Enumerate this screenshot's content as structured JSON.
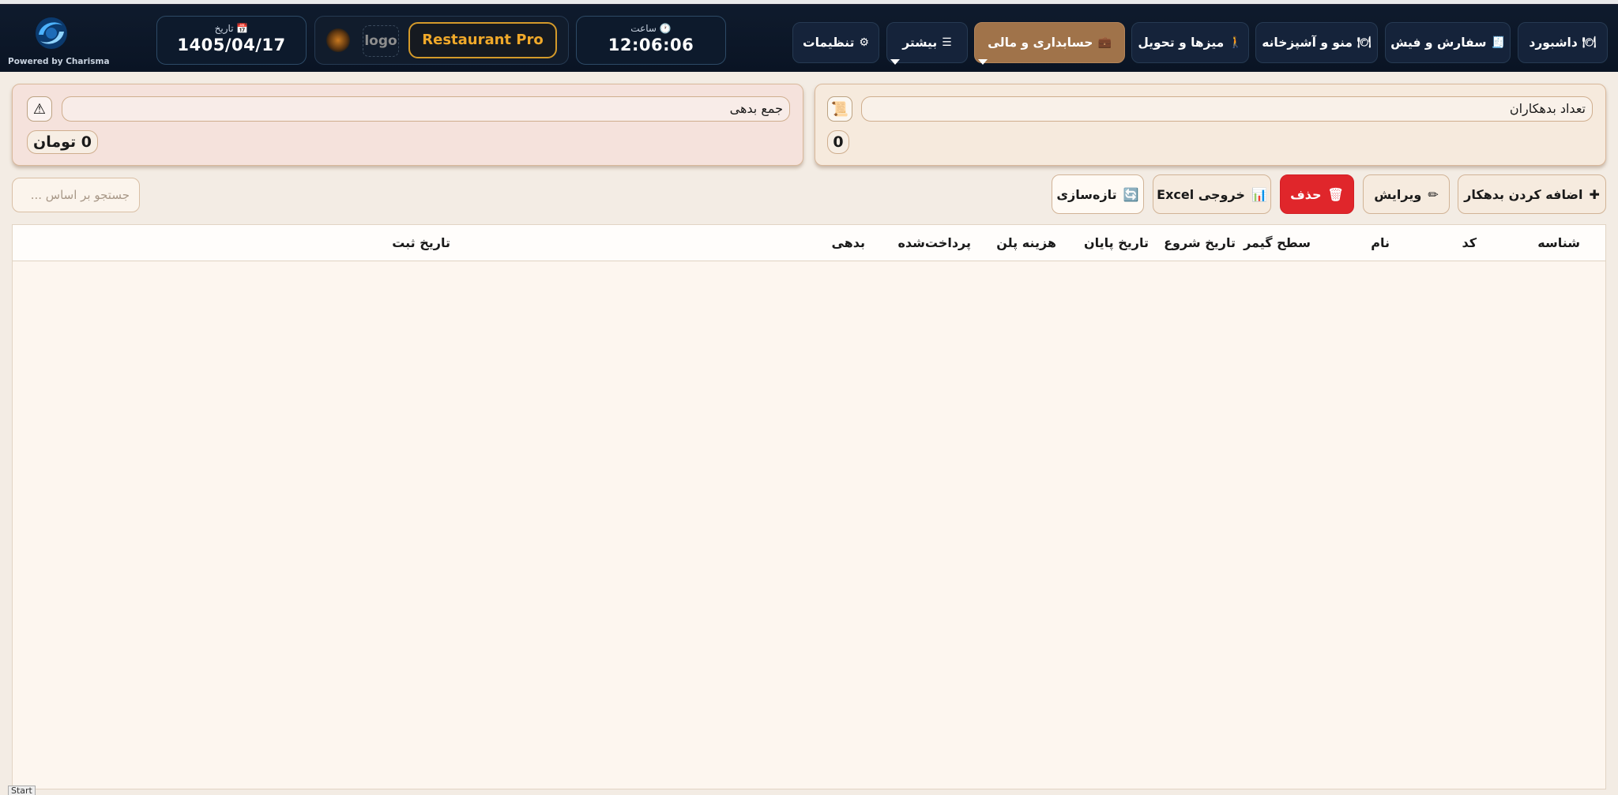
{
  "brand": {
    "powered_by": "Powered by Charisma"
  },
  "date": {
    "label": "تاریخ 📅",
    "value": "1405/04/17"
  },
  "logo": {
    "placeholder": "logo",
    "app_name": "Restaurant Pro"
  },
  "time": {
    "label": "ساعت 🕐",
    "value": "12:06:06"
  },
  "nav": {
    "dashboard": "داشبورد",
    "orders": "سفارش و فیش",
    "menu_kitchen": "منو و آشپزخانه",
    "tables_delivery": "میزها و تحویل",
    "accounting": "حسابداری و مالی",
    "more": "بیشتر",
    "settings": "تنظیمات"
  },
  "cards": {
    "debtor_count": {
      "title": "تعداد بدهکاران",
      "value": "0"
    },
    "total_debt": {
      "title": "جمع بدهی",
      "value": "0 تومان"
    }
  },
  "toolbar": {
    "add": "اضافه کردن بدهکار",
    "edit": "ویرایش",
    "delete": "حذف",
    "excel": "خروجی Excel",
    "refresh": "تازه‌سازی",
    "search_placeholder": "جستجو بر اساس ..."
  },
  "table": {
    "columns": [
      "شناسه",
      "کد",
      "نام",
      "سطح گیمر",
      "تاریخ شروع",
      "تاریخ پایان",
      "هزینه پلن",
      "پرداخت‌شده",
      "بدهی",
      "تاریخ ثبت"
    ],
    "rows": []
  },
  "footer": {
    "start": "Start"
  },
  "colors": {
    "navbar": "#0f1b2d",
    "accent": "#a0734a",
    "danger": "#e0262b",
    "brand_gold": "#f0a92a"
  }
}
